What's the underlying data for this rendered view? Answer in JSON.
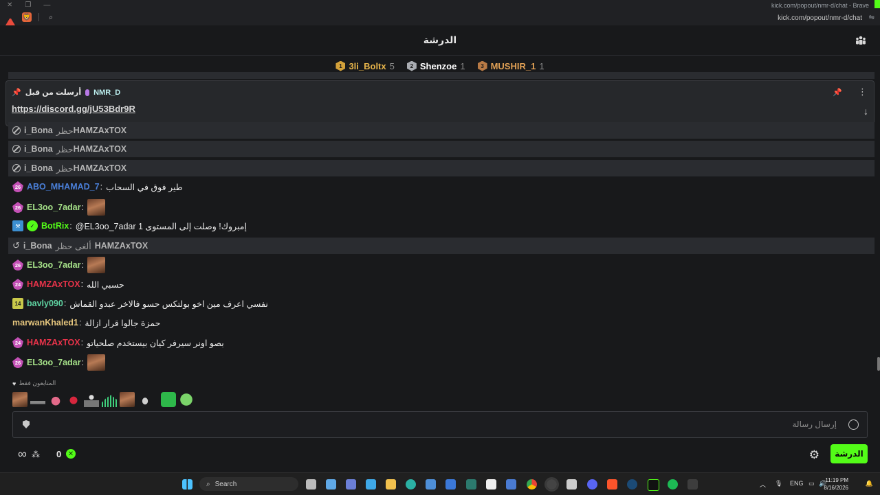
{
  "browser": {
    "window_title": "kick.com/popout/nmr-d/chat - Brave",
    "url": "kick.com/popout/nmr-d/chat"
  },
  "chat": {
    "title": "الدرشة",
    "leaderboard": [
      {
        "rank": "1",
        "name": "3li_Boltx",
        "count": "5",
        "color": "#e5b34a",
        "badge_color": "#d3a13a"
      },
      {
        "rank": "2",
        "name": "Shenzoe",
        "count": "1",
        "color": "#ffffff",
        "badge_color": "#a9acb2"
      },
      {
        "rank": "3",
        "name": "MUSHIR_1",
        "count": "1",
        "color": "#e0a055",
        "badge_color": "#b87a45"
      }
    ],
    "pinned": {
      "author": "NMR_D",
      "label": "أرسلت من قبل",
      "link": "https://discord.gg/jU53Bdr9R"
    },
    "messages": {
      "m0": {
        "user": "i_Bona",
        "action": "حظر",
        "target": "HAMZAxTOX"
      },
      "m1": {
        "user": "i_Bona",
        "action": "حظر",
        "target": "HAMZAxTOX"
      },
      "m2": {
        "user": "i_Bona",
        "action": "حظر",
        "target": "HAMZAxTOX"
      },
      "m3": {
        "badge": "26",
        "user": "ABO_MHAMAD_7",
        "sep": ":",
        "text": "طير فوق في السحاب",
        "color": "#4a7fd8"
      },
      "m4": {
        "badge": "26",
        "user": "EL3oo_7adar",
        "sep": ":",
        "color": "#a7e38a"
      },
      "m5": {
        "user": "BotRix",
        "sep": ":",
        "text": "@EL3oo_7adar إمبروك! وصلت إلى المستوى 1",
        "color": "#53fc18"
      },
      "m6": {
        "user": "i_Bona",
        "action": "ألغى حظر",
        "target": "HAMZAxTOX"
      },
      "m7": {
        "badge": "26",
        "user": "EL3oo_7adar",
        "sep": ":",
        "color": "#a7e38a"
      },
      "m8": {
        "badge": "24",
        "user": "HAMZAxTOX",
        "sep": ":",
        "text": "حسبي الله",
        "color": "#e8334a"
      },
      "m9": {
        "badge": "14",
        "user": "bavly090",
        "sep": ":",
        "text": "نفسي اعرف مين اخو بولتكس حسو فالاخر عبدو القماش",
        "color": "#5fd3a2"
      },
      "m10": {
        "user": "marwanKhaled1",
        "sep": ":",
        "text": "حمزة جالوا قرار ازالة",
        "color": "#e7c77e"
      },
      "m11": {
        "badge": "24",
        "user": "HAMZAxTOX",
        "sep": ":",
        "text": "بصو اونر سيرفر كيان بيستخدم صلحياتو",
        "color": "#e8334a"
      },
      "m12": {
        "badge": "26",
        "user": "EL3oo_7adar",
        "sep": ":",
        "color": "#a7e38a"
      }
    },
    "subs_only_label": "المتابعون فقط",
    "input_placeholder": "إرسال رسالة",
    "points_count": "0",
    "send_label": "الدرشة"
  },
  "taskbar": {
    "search_label": "Search",
    "lang": "ENG",
    "time": "11:19 PM",
    "date": "8/16/2026"
  },
  "colors": {
    "brand_green": "#53fc18",
    "sub_badge": "#c451b6",
    "background": "#18191b"
  }
}
